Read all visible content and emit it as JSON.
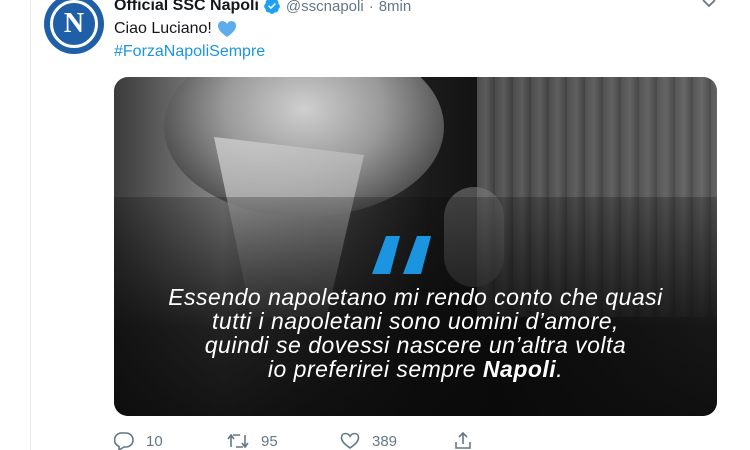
{
  "tweet": {
    "display_name": "Official SSC Napoli",
    "handle": "@sscnapoli",
    "separator": "·",
    "time": "8min",
    "text_line": "Ciao Luciano!",
    "hashtag": "#ForzaNapoliSempre",
    "verified": true,
    "avatar_letter": "N"
  },
  "media": {
    "quote_line1": "Essendo napoletano mi rendo conto che quasi",
    "quote_line2": "tutti i napoletani sono uomini d’amore,",
    "quote_line3": "quindi se dovessi nascere un’altra volta",
    "quote_line4_prefix": "io preferirei sempre ",
    "quote_line4_bold": "Napoli",
    "quote_line4_suffix": ".",
    "accent_color": "#1b95e0"
  },
  "actions": {
    "replies": "10",
    "retweets": "95",
    "likes": "389"
  },
  "icons": {
    "verified": "verified-badge-icon",
    "heart": "blue-heart-icon",
    "menu": "chevron-down-icon",
    "reply": "reply-icon",
    "retweet": "retweet-icon",
    "like": "like-icon",
    "share": "share-icon"
  }
}
